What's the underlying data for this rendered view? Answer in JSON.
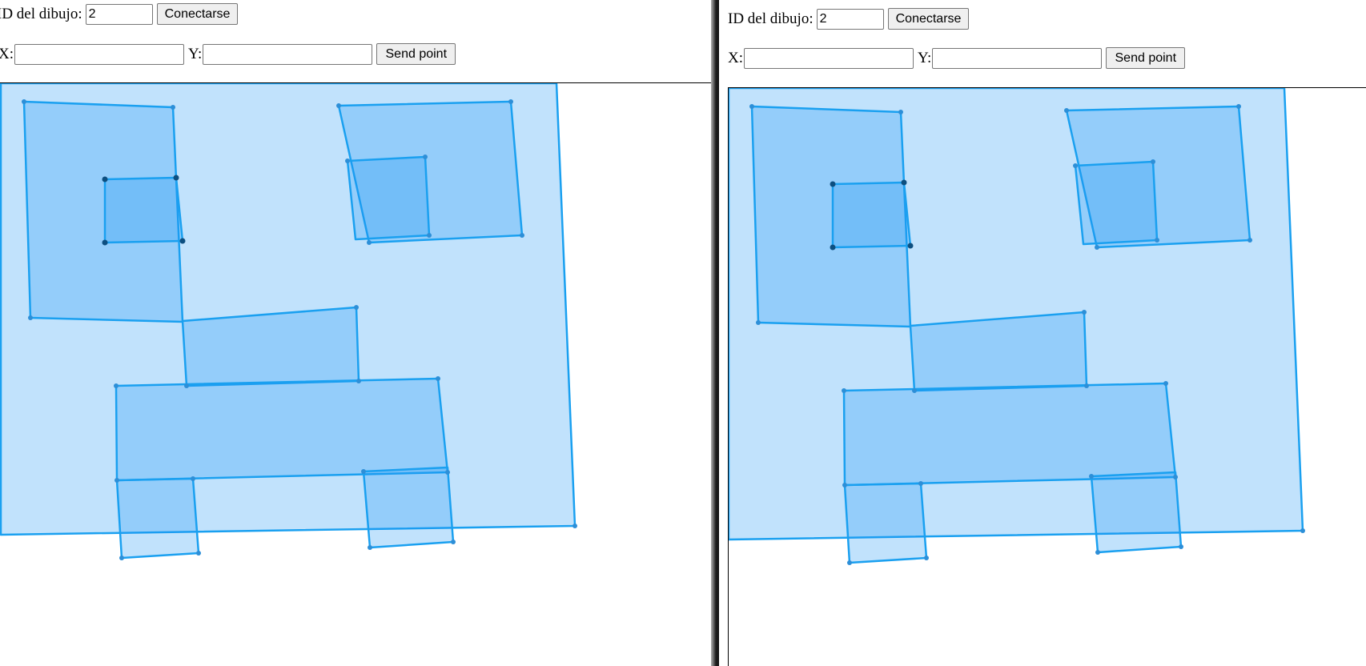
{
  "windows": [
    {
      "id": "left",
      "drawing_id_label": "ID del dibujo:",
      "drawing_id_value": "2",
      "connect_label": "Conectarse",
      "x_label": "X:",
      "x_value": "",
      "y_label": "Y:",
      "y_value": "",
      "send_label": "Send point"
    },
    {
      "id": "right",
      "drawing_id_label": "ID del dibujo:",
      "drawing_id_value": "2",
      "connect_label": "Conectarse",
      "x_label": "X:",
      "x_value": "",
      "y_label": "Y:",
      "y_value": "",
      "send_label": "Send point"
    }
  ],
  "colors": {
    "shape_fill": "#2196f3",
    "shape_stroke": "#1aa0f0",
    "vertex": "#2d8fd8",
    "vertex_dark": "#0d4f80"
  }
}
